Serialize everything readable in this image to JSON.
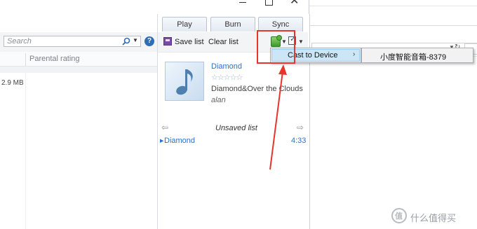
{
  "window": {
    "minimize_glyph": "—",
    "maximize_glyph": "□",
    "close_glyph": "✕"
  },
  "tabs": [
    {
      "label": "Play"
    },
    {
      "label": "Burn"
    },
    {
      "label": "Sync"
    }
  ],
  "library": {
    "search_placeholder": "Search",
    "column_parental_rating": "Parental rating",
    "row_size": "2.9 MB"
  },
  "toolbar": {
    "save_list_label": "Save list",
    "clear_list_label": "Clear list"
  },
  "now_playing": {
    "title": "Diamond",
    "rating_stars": "☆☆☆☆☆",
    "album": "Diamond&Over the Clouds",
    "artist": "alan"
  },
  "playlist": {
    "title": "Unsaved list",
    "prev_glyph": "⇦",
    "next_glyph": "⇨",
    "items": [
      {
        "title": "Diamond",
        "duration": "4:33"
      }
    ]
  },
  "context_menu": {
    "items": [
      {
        "label": "Cast to Device",
        "submenu_glyph": "›"
      }
    ],
    "submenu": {
      "device": "小度智能音箱-8379"
    }
  },
  "watermark": {
    "logo_char": "值",
    "text": "什么值得买"
  },
  "colors": {
    "accent": "#2a72c9",
    "annotation": "#e6352b",
    "menu_highlight": "#cde6f7"
  },
  "icons": [
    "search-icon",
    "help-icon",
    "save-list-icon",
    "list-options-icon",
    "checklist-icon",
    "music-note-icon",
    "annotation-arrow"
  ]
}
